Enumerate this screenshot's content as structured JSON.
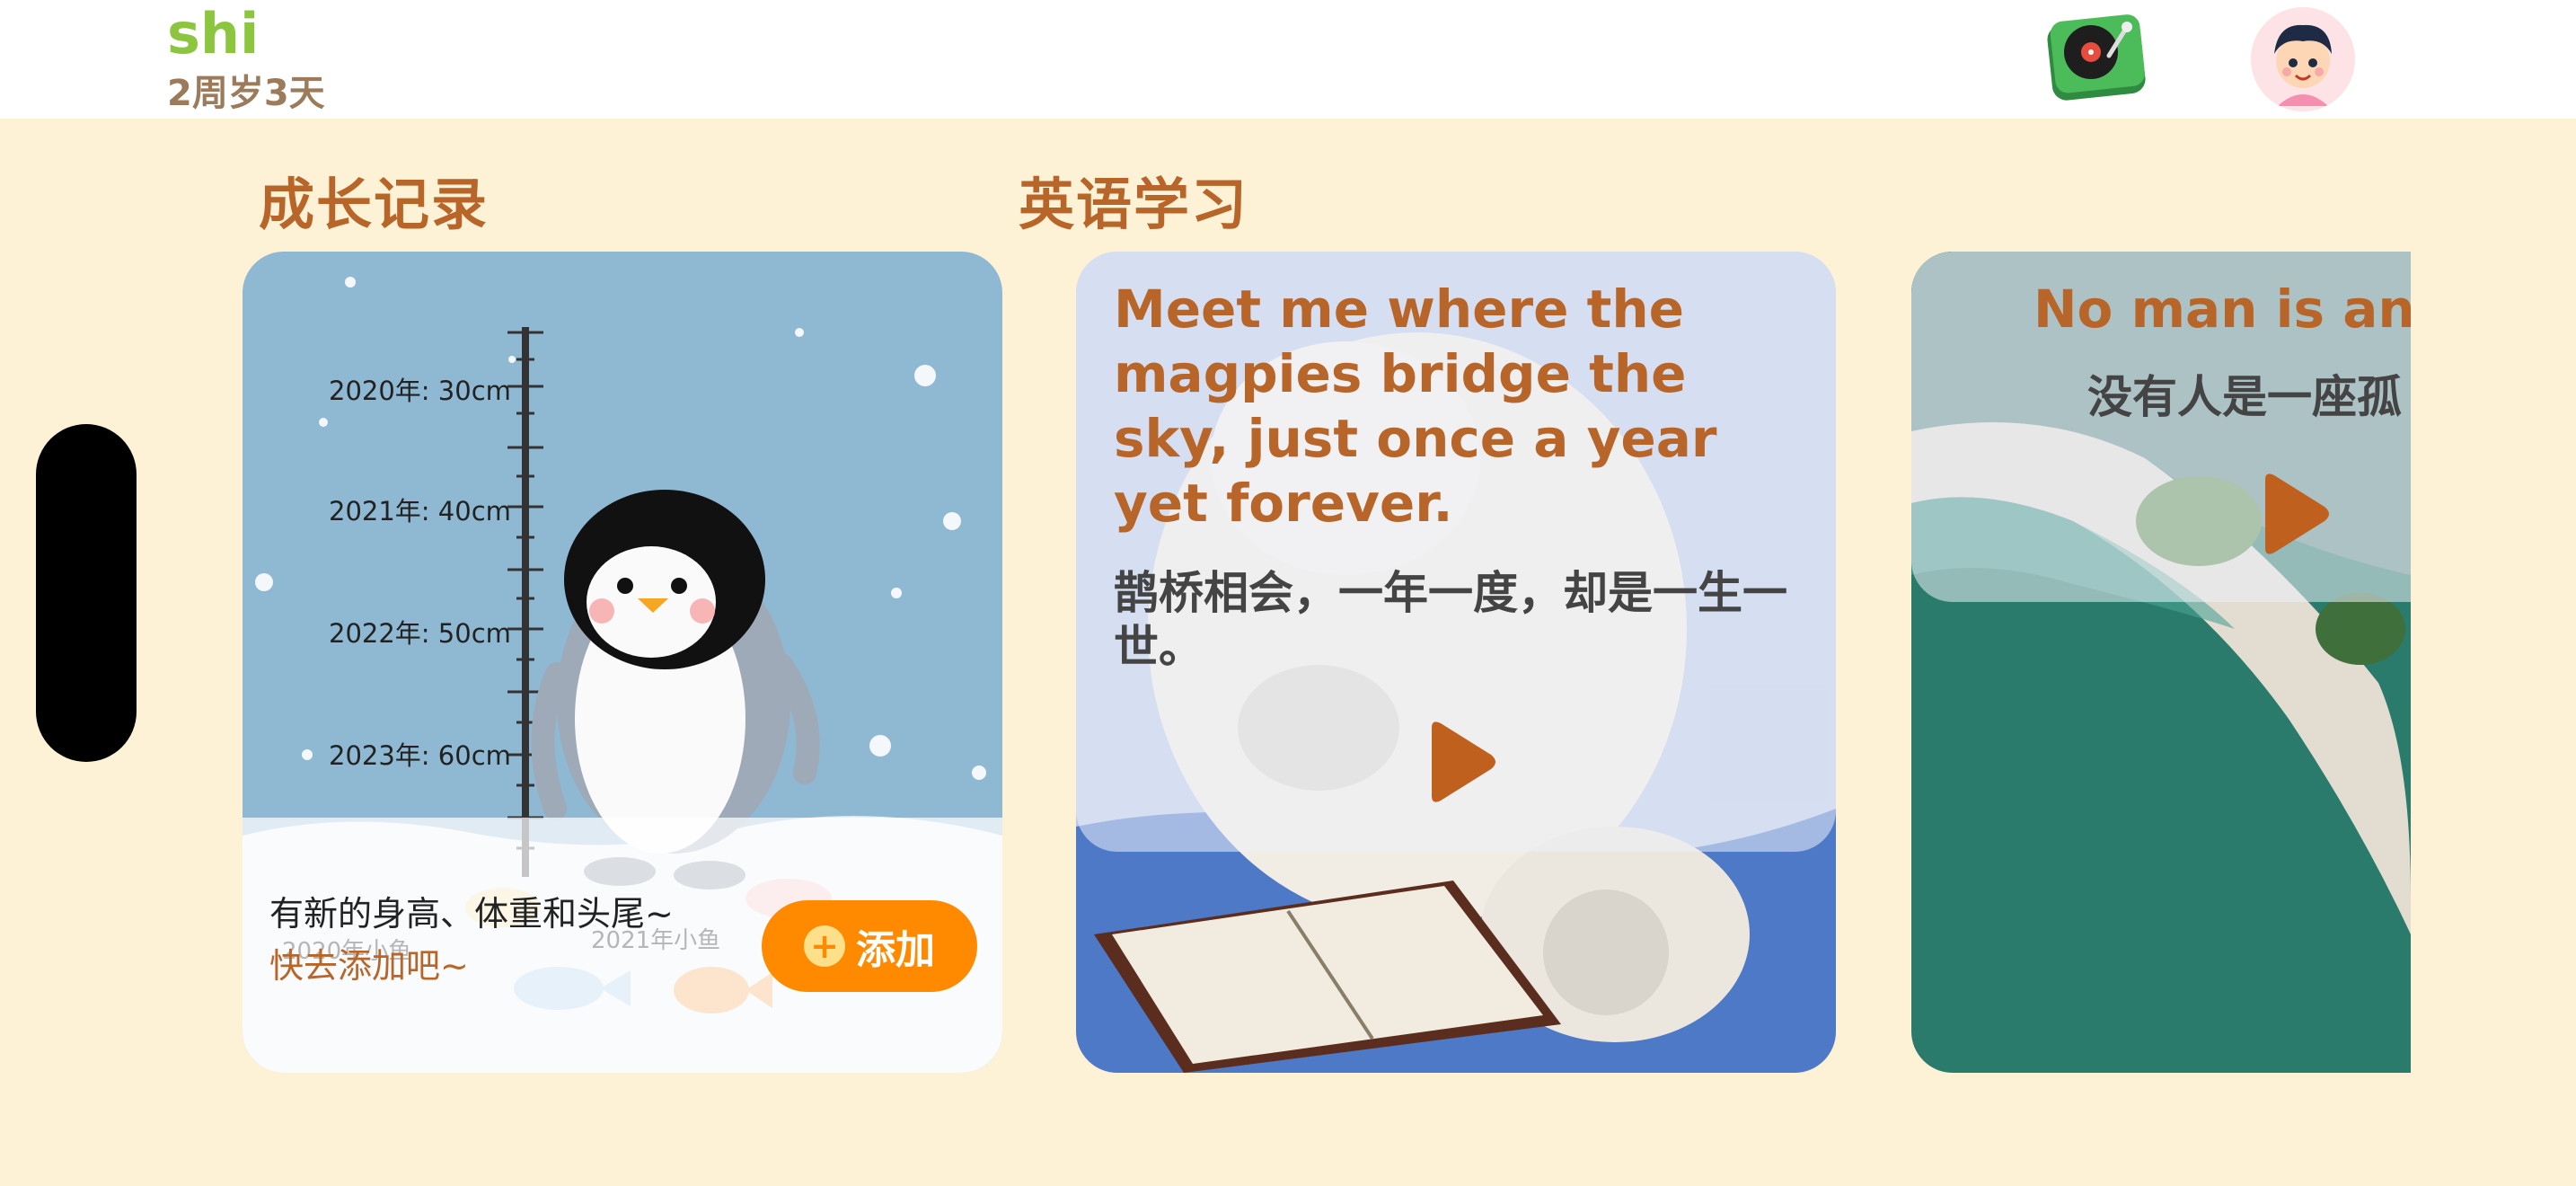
{
  "header": {
    "child_name": "shi",
    "child_age": "2周岁3天",
    "music_icon": "turntable-icon",
    "avatar_icon": "child-avatar-icon"
  },
  "sections": {
    "growth_title": "成长记录",
    "english_title": "英语学习"
  },
  "growth_card": {
    "ruler_labels": [
      "2020年: 30cm",
      "2021年: 40cm",
      "2022年: 50cm",
      "2023年: 60cm"
    ],
    "fish_labels": [
      "2020年小鱼",
      "2021年小鱼"
    ],
    "prompt_line_1": "有新的身高、体重和头尾~",
    "prompt_line_2": "快去添加吧~",
    "add_button_label": "添加"
  },
  "english_cards": [
    {
      "quote_en": "Meet me where the magpies bridge the sky, just once a year yet forever.",
      "quote_zh": "鹊桥相会，一年一度，却是一生一世。"
    },
    {
      "quote_en": "No man is an is",
      "quote_zh": "没有人是一座孤"
    }
  ],
  "colors": {
    "background": "#fdf1d6",
    "brand_green": "#8cc63f",
    "title_brown": "#b8652a",
    "accent_orange": "#ff8a00"
  }
}
